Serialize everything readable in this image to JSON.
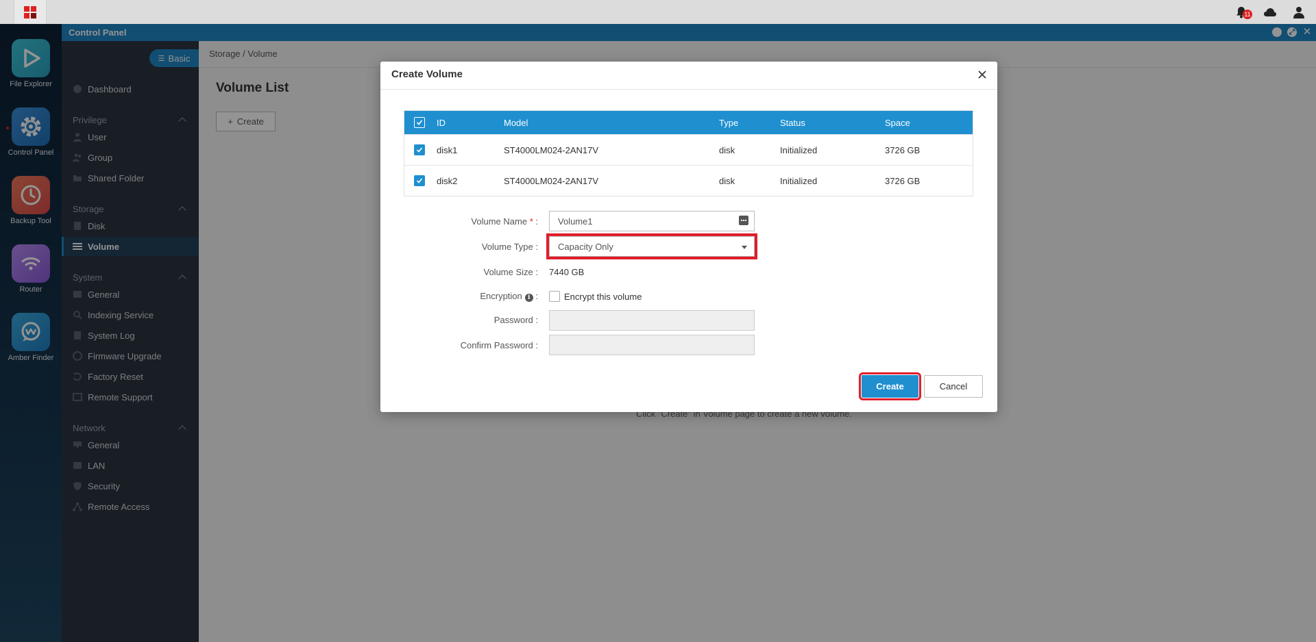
{
  "topbar": {
    "notification_count": "11"
  },
  "dock": {
    "items": [
      {
        "label": "File Explorer"
      },
      {
        "label": "Control Panel"
      },
      {
        "label": "Backup Tool"
      },
      {
        "label": "Router"
      },
      {
        "label": "Amber Finder"
      }
    ]
  },
  "window": {
    "title": "Control Panel"
  },
  "sidebar": {
    "mode_button": "Basic",
    "dashboard": "Dashboard",
    "sections": {
      "privilege": "Privilege",
      "storage": "Storage",
      "system": "System",
      "network": "Network"
    },
    "items": {
      "user": "User",
      "group": "Group",
      "shared_folder": "Shared Folder",
      "disk": "Disk",
      "volume": "Volume",
      "general": "General",
      "indexing_service": "Indexing Service",
      "system_log": "System Log",
      "firmware_upgrade": "Firmware Upgrade",
      "factory_reset": "Factory Reset",
      "remote_support": "Remote Support",
      "net_general": "General",
      "lan": "LAN",
      "security": "Security",
      "remote_access": "Remote Access"
    }
  },
  "content": {
    "breadcrumb": "Storage / Volume",
    "page_title": "Volume List",
    "create_button": "Create",
    "empty_hint": "Click \"Create\" in Volume page to create a new volume."
  },
  "dialog": {
    "title": "Create Volume",
    "table": {
      "columns": [
        "ID",
        "Model",
        "Type",
        "Status",
        "Space"
      ],
      "rows": [
        {
          "id": "disk1",
          "model": "ST4000LM024-2AN17V",
          "type": "disk",
          "status": "Initialized",
          "space": "3726 GB",
          "checked": true
        },
        {
          "id": "disk2",
          "model": "ST4000LM024-2AN17V",
          "type": "disk",
          "status": "Initialized",
          "space": "3726 GB",
          "checked": true
        }
      ]
    },
    "form": {
      "volume_name_label": "Volume Name",
      "volume_name_value": "Volume1",
      "volume_type_label": "Volume Type :",
      "volume_type_value": "Capacity Only",
      "volume_size_label": "Volume Size :",
      "volume_size_value": "7440 GB",
      "encryption_label": "Encryption",
      "encrypt_checkbox_label": "Encrypt this volume",
      "password_label": "Password :",
      "confirm_password_label": "Confirm Password :"
    },
    "create_button": "Create",
    "cancel_button": "Cancel"
  },
  "colors": {
    "accent": "#1f8fcf",
    "titlebar": "#1f86c4",
    "sidebar_bg": "#2b3440",
    "highlight": "#e01e2b"
  }
}
